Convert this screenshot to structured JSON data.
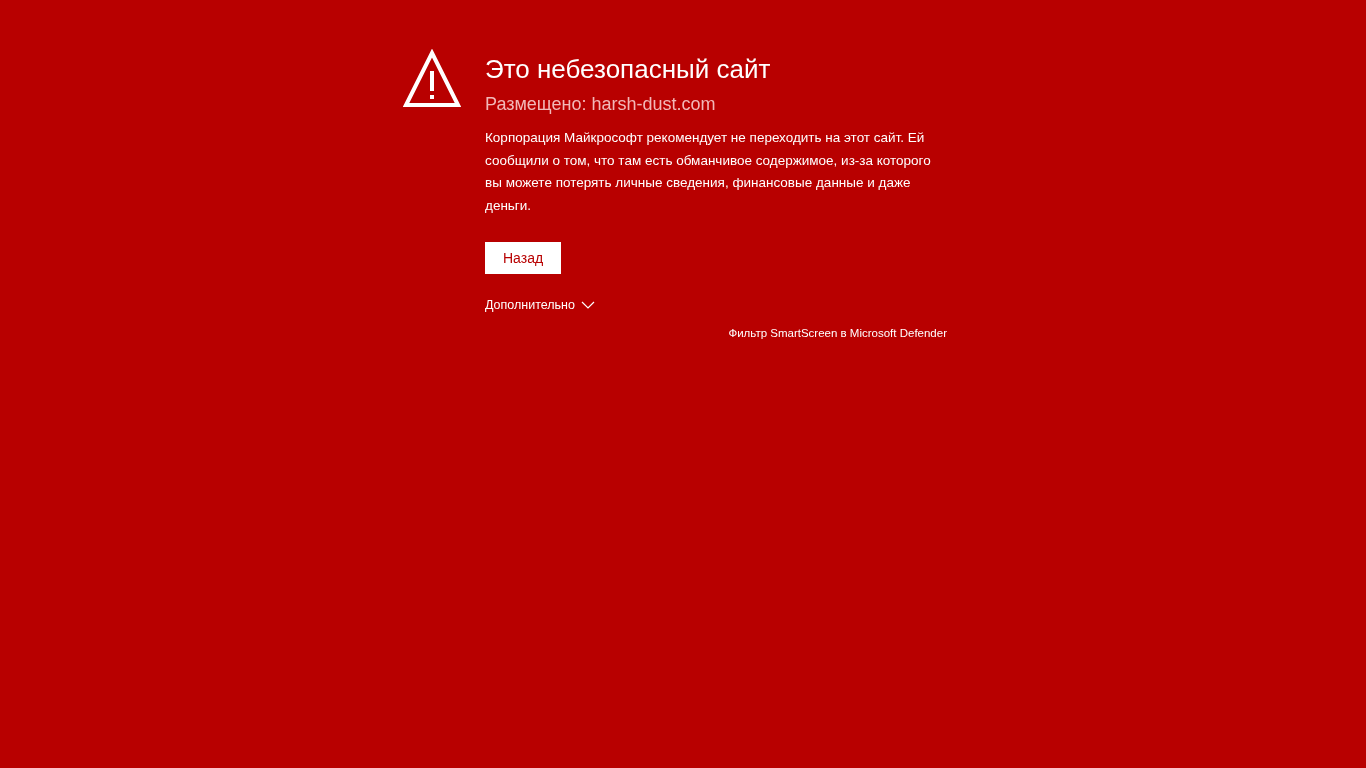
{
  "title": "Это небезопасный сайт",
  "subtitle": "Размещено: harsh-dust.com",
  "message": "Корпорация Майкрософт рекомендует не переходить на этот сайт. Ей сообщили о том, что там есть обманчивое содержимое, из-за которого вы можете потерять личные сведения, финансовые данные и даже деньги.",
  "back_button": "Назад",
  "more_details": {
    "label": "Дополнительно",
    "expanded": false
  },
  "footer": "Фильтр SmartScreen в Microsoft Defender"
}
